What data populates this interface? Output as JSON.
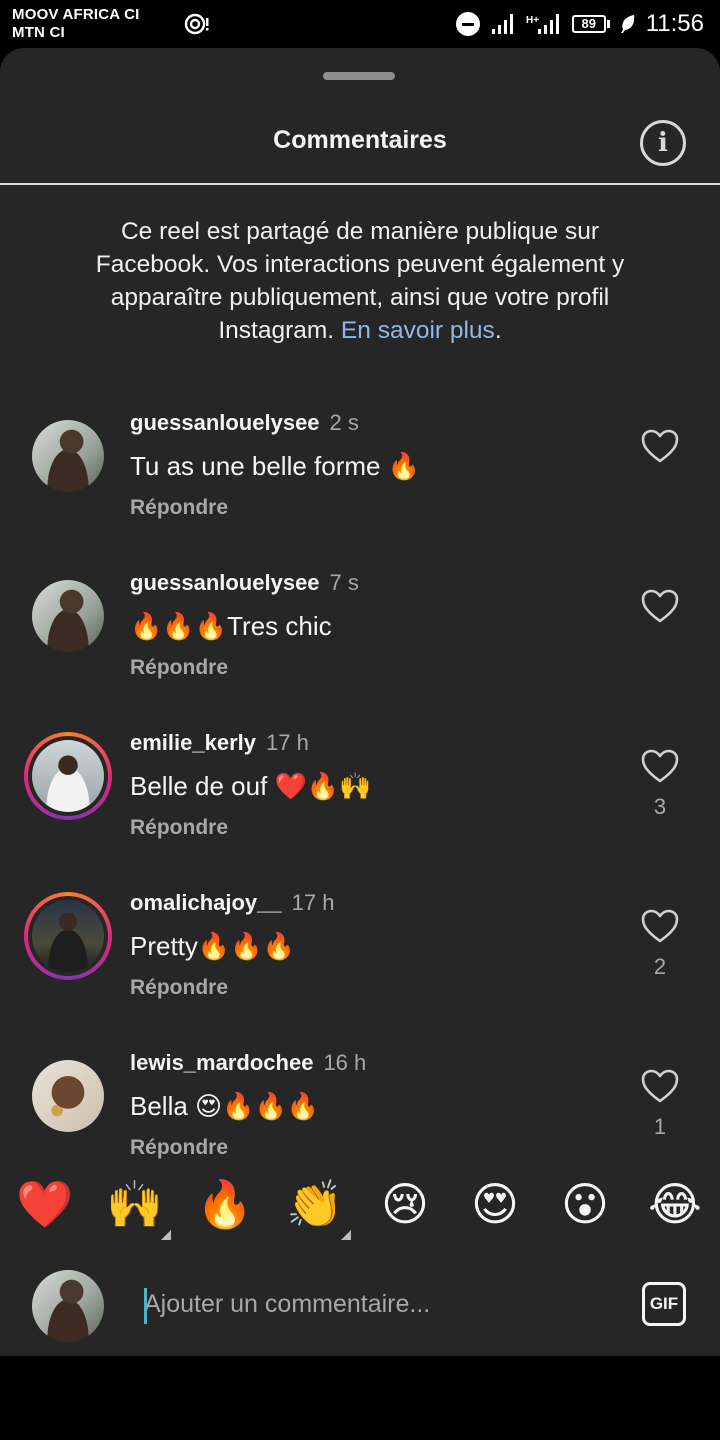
{
  "status_bar": {
    "carrier_line1": "MOOV AFRICA CI",
    "carrier_line2": "MTN CI",
    "battery": "89",
    "time": "11:56",
    "icons": [
      "hotspot-icon",
      "do-not-disturb-icon",
      "signal-icon",
      "battery-icon",
      "battery-saver-leaf-icon"
    ]
  },
  "sheet": {
    "title": "Commentaires",
    "info_icon": "info-icon",
    "notice": "Ce reel est partagé de manière publique sur Facebook. Vos interactions peuvent également y apparaître publiquement, ainsi que votre profil Instagram.",
    "notice_link": "En savoir plus",
    "notice_end": "."
  },
  "comments": [
    {
      "username": "guessanlouelysee",
      "time": "2 s",
      "text": "Tu as une belle forme 🔥",
      "reply": "Répondre",
      "likes": "",
      "story_ring": false
    },
    {
      "username": "guessanlouelysee",
      "time": "7 s",
      "text": "🔥🔥🔥Tres chic",
      "reply": "Répondre",
      "likes": "",
      "story_ring": false
    },
    {
      "username": "emilie_kerly",
      "time": "17 h",
      "text": "Belle de ouf ❤️🔥🙌",
      "reply": "Répondre",
      "likes": "3",
      "story_ring": true
    },
    {
      "username": "omalichajoy__",
      "time": "17 h",
      "text": "Pretty🔥🔥🔥",
      "reply": "Répondre",
      "likes": "2",
      "story_ring": true
    },
    {
      "username": "lewis_mardochee",
      "time": "16 h",
      "text": "Bella 😍🔥🔥🔥",
      "reply": "Répondre",
      "likes": "1",
      "story_ring": false
    }
  ],
  "emoji_bar": [
    "❤️",
    "🙌",
    "🔥",
    "👏",
    "😢",
    "😍",
    "😮",
    "😂"
  ],
  "composer": {
    "placeholder": "Ajouter un commentaire...",
    "gif_label": "GIF"
  },
  "colors": {
    "sheet_background": "#262626",
    "link": "#8fb8e8",
    "secondary_text": "#a8a8a8"
  }
}
